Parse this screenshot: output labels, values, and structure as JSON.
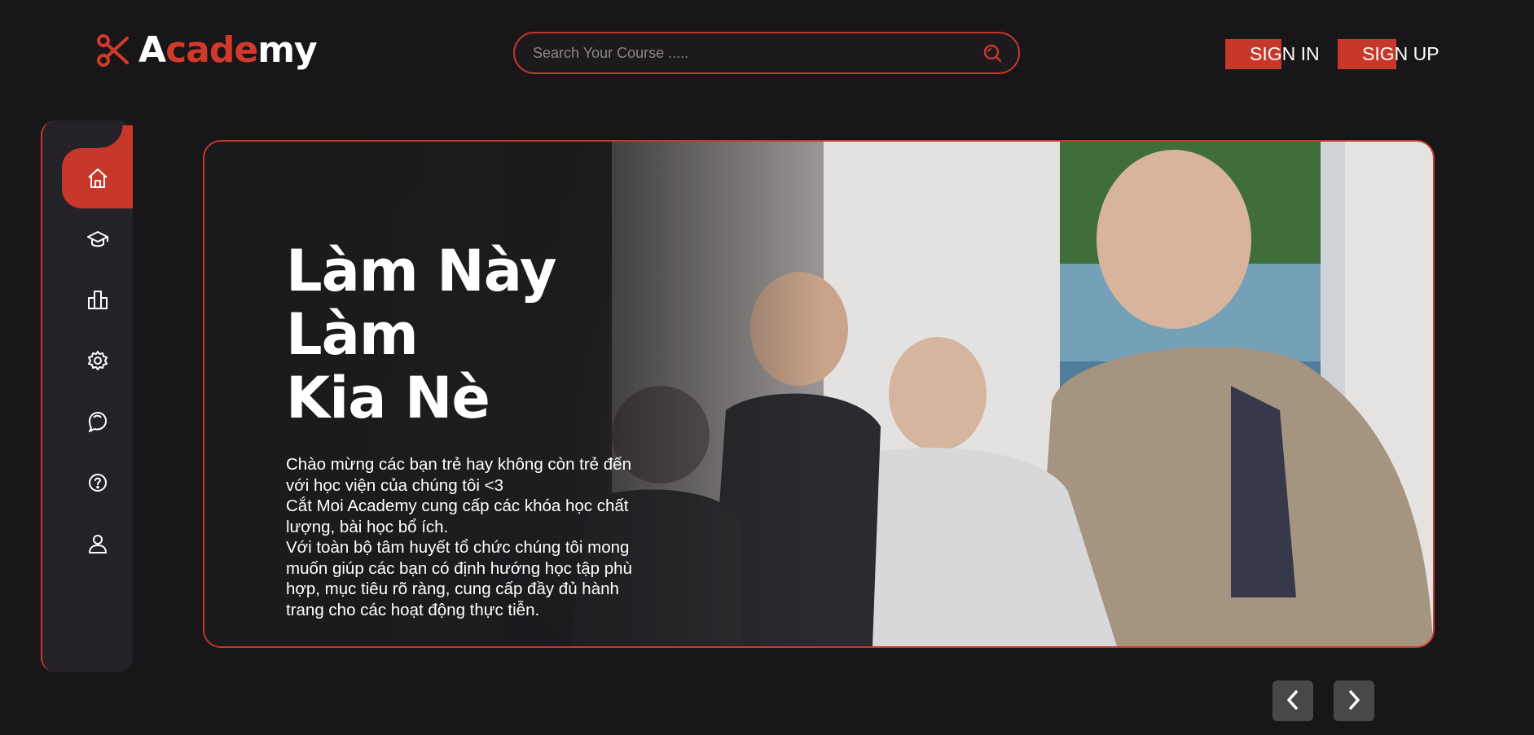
{
  "brand": {
    "logo_text_parts": [
      "A",
      "cade",
      "my"
    ],
    "logo_icon": "scissors-icon",
    "colors": {
      "accent": "#c8382a",
      "background": "#19161a",
      "sidebar": "#242226"
    }
  },
  "search": {
    "placeholder": "Search Your Course .....",
    "value": "",
    "icon": "search-icon"
  },
  "auth": {
    "sign_in_label": "SIGN IN",
    "sign_up_label": "SIGN UP"
  },
  "sidebar": {
    "items": [
      {
        "icon": "home-icon",
        "active": true
      },
      {
        "icon": "graduation-cap-icon",
        "active": false
      },
      {
        "icon": "buildings-icon",
        "active": false
      },
      {
        "icon": "gear-icon",
        "active": false
      },
      {
        "icon": "chat-icon",
        "active": false
      },
      {
        "icon": "help-icon",
        "active": false
      },
      {
        "icon": "user-icon",
        "active": false
      }
    ]
  },
  "hero": {
    "title_lines": [
      "Làm Này Làm",
      "Kia Nè"
    ],
    "body_paragraphs": [
      "Chào mừng các bạn trẻ hay không còn trẻ đến với học viện của chúng tôi <3",
      "Cắt Moi Academy cung cấp các khóa học chất lượng, bài học bổ ích.",
      "Với toàn bộ tâm huyết tổ chức chúng tôi mong muốn giúp các bạn có định hướng học tập phù hợp, mục tiêu rõ ràng, cung cấp đầy đủ hành trang cho các hoạt động thực tiễn."
    ]
  },
  "carousel": {
    "prev_icon": "chevron-left-icon",
    "next_icon": "chevron-right-icon"
  }
}
